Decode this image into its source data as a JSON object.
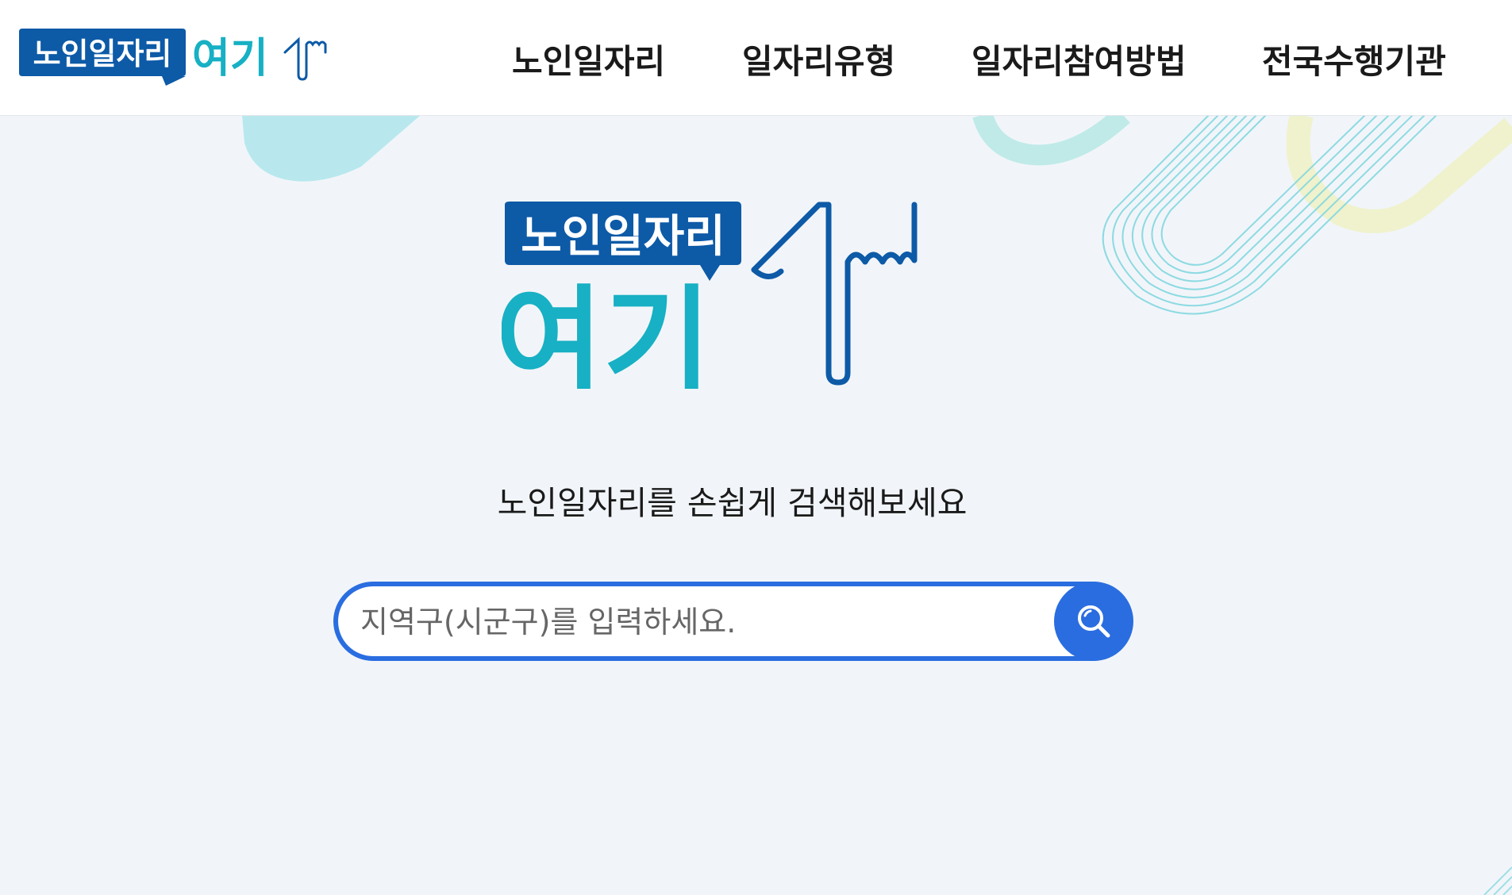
{
  "header": {
    "logo": {
      "top_text": "노인일자리",
      "bottom_text": "여기"
    },
    "nav": [
      {
        "label": "노인일자리"
      },
      {
        "label": "일자리유형"
      },
      {
        "label": "일자리참여방법"
      },
      {
        "label": "전국수행기관"
      }
    ]
  },
  "hero": {
    "logo": {
      "top_text": "노인일자리",
      "bottom_text": "여기"
    },
    "tagline": "노인일자리를 손쉽게 검색해보세요",
    "search": {
      "placeholder": "지역구(시군구)를 입력하세요.",
      "value": "",
      "button_icon": "search-icon"
    }
  },
  "colors": {
    "brand_blue": "#0d5aa7",
    "brand_teal": "#17b0c4",
    "accent_blue": "#2a6de0",
    "background": "#f1f5f9"
  }
}
